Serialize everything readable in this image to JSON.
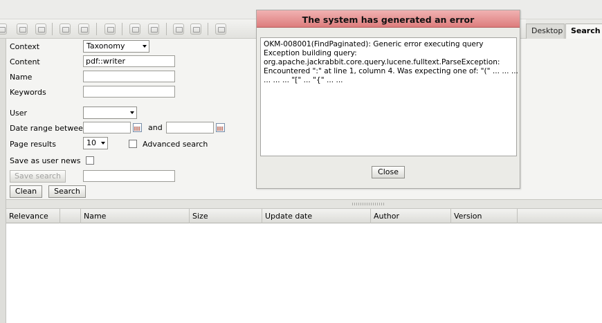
{
  "toolbar": {
    "icons": [
      "new-document-icon",
      "new-folder-icon",
      "lock-icon",
      "add-document-icon",
      "remove-document-icon",
      "gear-icon",
      "save-icon",
      "save-as-icon",
      "refresh-icon",
      "home-icon",
      "print-icon"
    ]
  },
  "tabs": {
    "desktop": "Desktop",
    "search": "Search"
  },
  "form": {
    "context_label": "Context",
    "context_value": "Taxonomy",
    "content_label": "Content",
    "content_value": "pdf::writer",
    "name_label": "Name",
    "name_value": "",
    "keywords_label": "Keywords",
    "keywords_value": "",
    "user_label": "User",
    "user_value": "",
    "date_range_label": "Date range between",
    "and_label": "and",
    "page_results_label": "Page results",
    "page_results_value": "10",
    "advanced_search_label": "Advanced search",
    "save_as_user_news_label": "Save as user news",
    "save_search_label": "Save search",
    "clean_label": "Clean",
    "search_label": "Search"
  },
  "grid": {
    "columns": [
      "Relevance",
      "",
      "Name",
      "Size",
      "Update date",
      "Author",
      "Version"
    ]
  },
  "dialog": {
    "title": "The system has generated an error",
    "lines": [
      "OKM-008001(FindPaginated): Generic error executing query",
      "",
      "Exception building query:",
      "org.apache.jackrabbit.core.query.lucene.fulltext.ParseException:",
      "Encountered \":\" at line 1, column 4. Was expecting one of: \"(\" ... ... ...",
      "... ... ... \"[\" ... \"{\" ... ..."
    ],
    "close_label": "Close"
  },
  "colors": {
    "dialog_title_bg": "#e39393",
    "background": "#e9e9e6"
  }
}
